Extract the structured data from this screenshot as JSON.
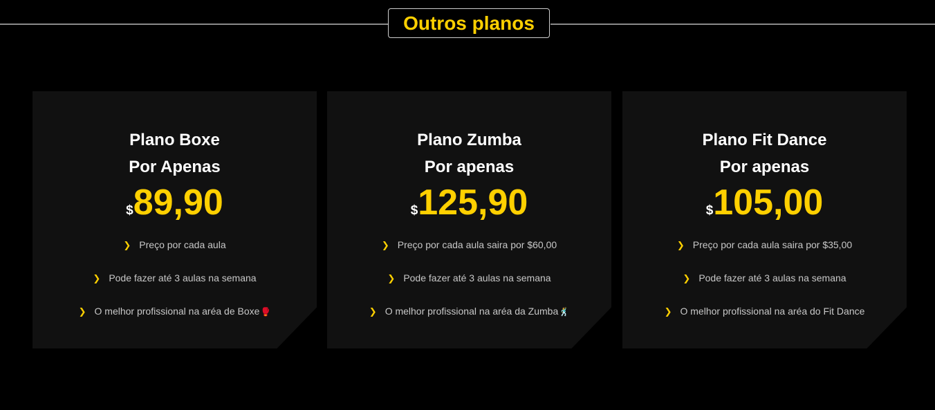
{
  "section": {
    "title": "Outros planos"
  },
  "colors": {
    "accent": "#ffd000",
    "card_bg": "#111111",
    "page_bg": "#000000",
    "text": "#ffffff",
    "muted_text": "#c8c8c8"
  },
  "plans": [
    {
      "title": "Plano Boxe",
      "subtitle": "Por Apenas",
      "currency": "$",
      "price": "89,90",
      "features": [
        {
          "icon": "chevron-right-icon",
          "text": "Preço por cada aula"
        },
        {
          "icon": "chevron-right-icon",
          "text": "Pode fazer até 3 aulas na semana"
        },
        {
          "icon": "chevron-right-icon",
          "text": "O melhor profissional na aréa de Boxe",
          "emoji": "🥊"
        }
      ]
    },
    {
      "title": "Plano Zumba",
      "subtitle": "Por apenas",
      "currency": "$",
      "price": "125,90",
      "features": [
        {
          "icon": "chevron-right-icon",
          "text": "Preço por cada aula saira por $60,00"
        },
        {
          "icon": "chevron-right-icon",
          "text": "Pode fazer até 3 aulas na semana"
        },
        {
          "icon": "chevron-right-icon",
          "text": "O melhor profissional na aréa da Zumba",
          "emoji": "🕺"
        }
      ]
    },
    {
      "title": "Plano Fit Dance",
      "subtitle": "Por apenas",
      "currency": "$",
      "price": "105,00",
      "features": [
        {
          "icon": "chevron-right-icon",
          "text": "Preço por cada aula saira por $35,00"
        },
        {
          "icon": "chevron-right-icon",
          "text": "Pode fazer até 3 aulas na semana"
        },
        {
          "icon": "chevron-right-icon",
          "text": "O melhor profissional na aréa do Fit Dance"
        }
      ]
    }
  ]
}
